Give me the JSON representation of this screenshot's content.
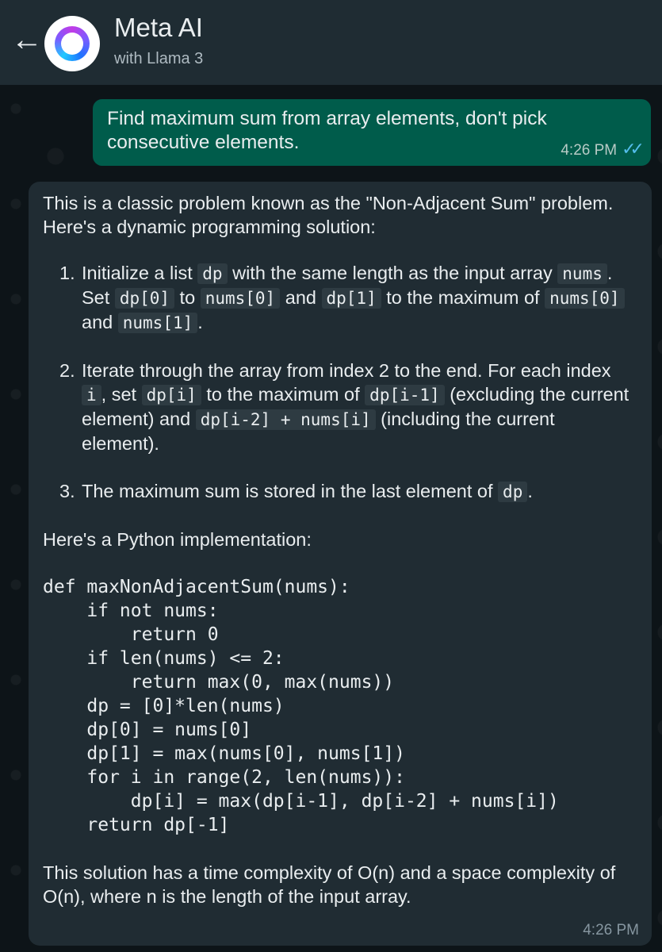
{
  "header": {
    "back_icon": "arrow-left-icon",
    "title": "Meta AI",
    "subtitle": "with Llama 3"
  },
  "outgoing": {
    "text": "Find maximum sum from array elements, don't pick consecutive elements.",
    "time": "4:26 PM",
    "status_icon": "double-check-icon",
    "status_color": "#53bdeb"
  },
  "reply": {
    "intro": "This is a classic problem known as the \"Non-Adjacent Sum\" problem. Here's a dynamic programming solution:",
    "steps": [
      {
        "number": "1.",
        "t1": "Initialize a list ",
        "c1": "dp",
        "t2": " with the same length as the input array ",
        "c2": "nums",
        "t3": ". Set ",
        "c3": "dp[0]",
        "t4": " to ",
        "c4": "nums[0]",
        "t5": " and ",
        "c5": "dp[1]",
        "t6": " to the maximum of ",
        "c6": "nums[0]",
        "t7": " and ",
        "c7": "nums[1]",
        "t8": "."
      },
      {
        "number": "2.",
        "t1": "Iterate through the array from index 2 to the end. For each index ",
        "c1": "i",
        "t2": ", set ",
        "c2": "dp[i]",
        "t3": " to the maximum of ",
        "c3": "dp[i-1]",
        "t4": " (excluding the current element) and ",
        "c4": "dp[i-2] + nums[i]",
        "t5": " (including the current element)."
      },
      {
        "number": "3.",
        "t1": "The maximum sum is stored in the last element of ",
        "c1": "dp",
        "t2": "."
      }
    ],
    "impl_label": "Here's a Python implementation:",
    "code": "def maxNonAdjacentSum(nums):\n    if not nums:\n        return 0\n    if len(nums) <= 2:\n        return max(0, max(nums))\n    dp = [0]*len(nums)\n    dp[0] = nums[0]\n    dp[1] = max(nums[0], nums[1])\n    for i in range(2, len(nums)):\n        dp[i] = max(dp[i-1], dp[i-2] + nums[i])\n    return dp[-1]",
    "closing": "This solution has a time complexity of O(n) and a space complexity of O(n), where n is the length of the input array.",
    "time": "4:26 PM"
  },
  "colors": {
    "header_bg": "#1f2c33",
    "outgoing_bubble": "#005c4b",
    "incoming_bubble": "#202c33",
    "inline_code_bg": "#2e3b42"
  }
}
